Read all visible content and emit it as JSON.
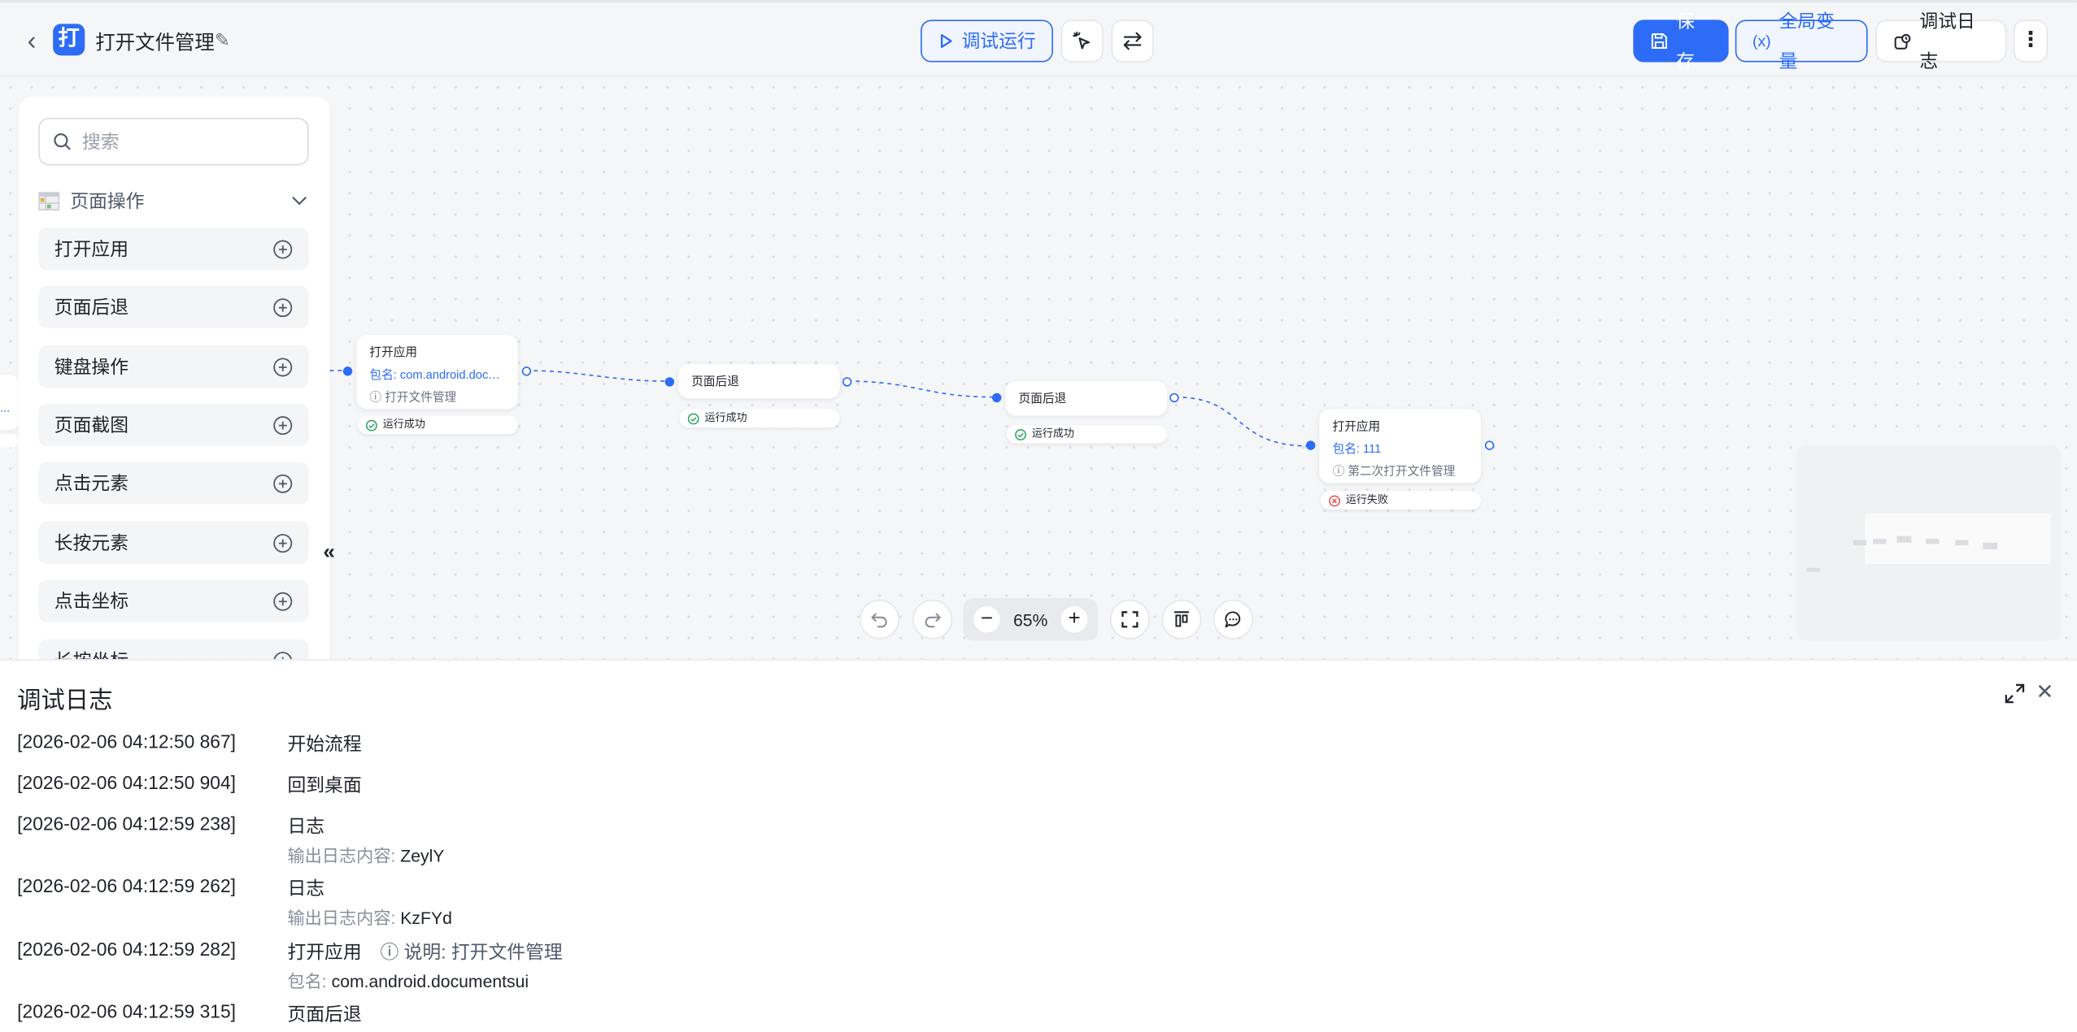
{
  "header": {
    "title": "打开文件管理",
    "debug_run": "调试运行",
    "save": "保存",
    "globals": "全局变量",
    "debug_log": "调试日志",
    "app_badge": "打"
  },
  "palette": {
    "search_placeholder": "搜索",
    "section": "页面操作",
    "items": [
      {
        "label": "打开应用"
      },
      {
        "label": "页面后退"
      },
      {
        "label": "键盘操作"
      },
      {
        "label": "页面截图"
      },
      {
        "label": "点击元素"
      },
      {
        "label": "长按元素"
      },
      {
        "label": "点击坐标"
      },
      {
        "label": "长按坐标"
      }
    ]
  },
  "nodes": [
    {
      "title": "打开应用",
      "pkg": "包名: com.android.docum...",
      "desc": "打开文件管理",
      "status": "运行成功"
    },
    {
      "title": "页面后退",
      "status": "运行成功"
    },
    {
      "title": "页面后退",
      "status": "运行成功"
    },
    {
      "title": "打开应用",
      "pkg": "包名: 111",
      "desc": "第二次打开文件管理",
      "status": "运行失败"
    }
  ],
  "edge_partial_label": "...",
  "zoom": "65%",
  "colors": {
    "accent": "#2c6cf6",
    "success": "#22a05b",
    "fail": "#e5484d"
  },
  "log": {
    "title": "调试日志",
    "entries": [
      {
        "time": "[2026-02-06 04:12:50 867]",
        "msg": "开始流程"
      },
      {
        "time": "[2026-02-06 04:12:50 904]",
        "msg": "回到桌面"
      },
      {
        "time": "[2026-02-06 04:12:59 238]",
        "msg": "日志",
        "detail_key": "输出日志内容:",
        "detail_val": "ZeylY"
      },
      {
        "time": "[2026-02-06 04:12:59 262]",
        "msg": "日志",
        "detail_key": "输出日志内容:",
        "detail_val": "KzFYd"
      },
      {
        "time": "[2026-02-06 04:12:59 282]",
        "msg": "打开应用",
        "note": "说明: 打开文件管理",
        "detail_key": "包名:",
        "detail_val": "com.android.documentsui"
      },
      {
        "time": "[2026-02-06 04:12:59 315]",
        "msg": "页面后退"
      }
    ]
  }
}
